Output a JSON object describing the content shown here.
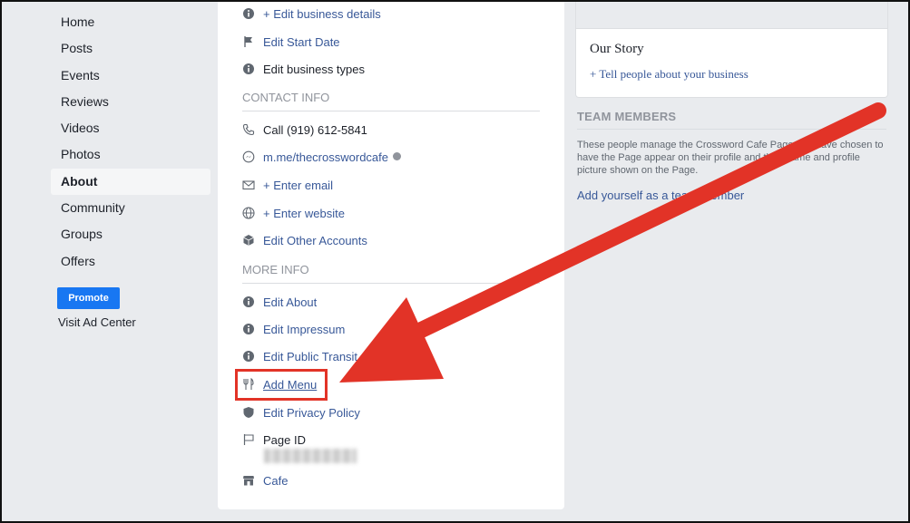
{
  "nav": {
    "items": [
      {
        "label": "Home"
      },
      {
        "label": "Posts"
      },
      {
        "label": "Events"
      },
      {
        "label": "Reviews"
      },
      {
        "label": "Videos"
      },
      {
        "label": "Photos"
      },
      {
        "label": "About",
        "active": true
      },
      {
        "label": "Community"
      },
      {
        "label": "Groups"
      },
      {
        "label": "Offers"
      }
    ],
    "promote_label": "Promote",
    "visit_ad_center": "Visit Ad Center"
  },
  "about": {
    "edit_business_details": "+ Edit business details",
    "edit_start_date": "Edit Start Date",
    "edit_business_types": "Edit business types",
    "contact_info_header": "CONTACT INFO",
    "call": "Call (919) 612-5841",
    "messenger": "m.me/thecrosswordcafe",
    "enter_email": "+ Enter email",
    "enter_website": "+ Enter website",
    "edit_other_accounts": "Edit Other Accounts",
    "more_info_header": "MORE INFO",
    "edit_about": "Edit About",
    "edit_impressum": "Edit Impressum",
    "edit_public_transit": "Edit Public Transit",
    "add_menu": "Add Menu",
    "edit_privacy_policy": "Edit Privacy Policy",
    "page_id_label": "Page ID",
    "category": "Cafe"
  },
  "story": {
    "title": "Our Story",
    "link": "+ Tell people about your business"
  },
  "team": {
    "header": "TEAM MEMBERS",
    "description": "These people manage the Crossword Cafe Page and have chosen to have the Page appear on their profile and their name and profile picture shown on the Page.",
    "add_link": "Add yourself as a team member"
  },
  "colors": {
    "link": "#385898",
    "annotation": "#e23327",
    "promote": "#1877f2"
  }
}
